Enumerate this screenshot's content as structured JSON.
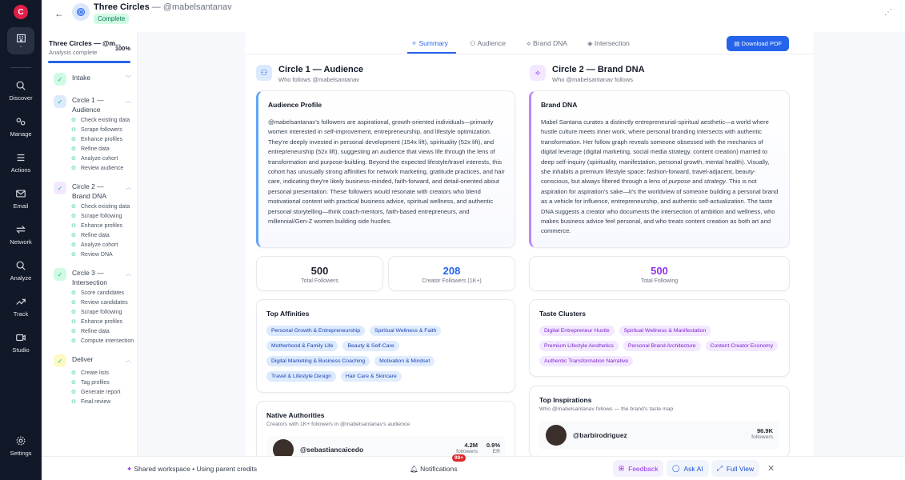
{
  "nav": {
    "logo_text": "C",
    "items": [
      {
        "label": "Discover",
        "icon": "search-icon"
      },
      {
        "label": "Manage",
        "icon": "people-icon"
      },
      {
        "label": "Actions",
        "icon": "list-icon"
      },
      {
        "label": "Email",
        "icon": "mail-icon"
      },
      {
        "label": "Network",
        "icon": "arrows-icon"
      },
      {
        "label": "Analyze",
        "icon": "magnifier-icon"
      },
      {
        "label": "Track",
        "icon": "trend-icon"
      },
      {
        "label": "Studio",
        "icon": "video-icon"
      }
    ],
    "settings": "Settings"
  },
  "header": {
    "title": "Three Circles",
    "handle": " — @mabelsantanav",
    "status": "Complete"
  },
  "sidebar": {
    "title": "Three Circles — @m...",
    "subtitle": "Analysis complete",
    "percent": "100%",
    "progress": 1.0,
    "stages": [
      {
        "name": "Intake",
        "color": "#d1fae5",
        "steps": []
      },
      {
        "name": "Circle 1 — Audience",
        "color": "#dbeafe",
        "steps": [
          "Check existing data",
          "Scrape followers",
          "Enhance profiles",
          "Refine data",
          "Analyze cohort",
          "Review audience"
        ]
      },
      {
        "name": "Circle 2 — Brand DNA",
        "color": "#f3e8ff",
        "steps": [
          "Check existing data",
          "Scrape following",
          "Enhance profiles",
          "Refine data",
          "Analyze cohort",
          "Review DNA"
        ]
      },
      {
        "name": "Circle 3 — Intersection",
        "color": "#d1fae5",
        "steps": [
          "Score candidates",
          "Review candidates",
          "Scrape following",
          "Enhance profiles",
          "Refine data",
          "Compute intersection"
        ]
      },
      {
        "name": "Deliver",
        "color": "#fef9c3",
        "steps": [
          "Create lists",
          "Tag profiles",
          "Generate report",
          "Final review"
        ]
      }
    ]
  },
  "tabs": [
    "Summary",
    "Audience",
    "Brand DNA",
    "Intersection"
  ],
  "download_label": "Download PDF",
  "circle1": {
    "title": "Circle 1 — Audience",
    "subtitle": "Who follows @mabelsantanav",
    "profile_title": "Audience Profile",
    "profile_text": "@mabelsantanav's followers are aspirational, growth-oriented individuals—primarily women interested in self-improvement, entrepreneurship, and lifestyle optimization. They're deeply invested in personal development (154x lift), spirituality (52x lift), and entrepreneurship (52x lift), suggesting an audience that views life through the lens of transformation and purpose-building. Beyond the expected lifestyle/travel interests, this cohort has unusually strong affinities for network marketing, gratitude practices, and hair care, indicating they're likely business-minded, faith-forward, and detail-oriented about personal presentation. These followers would resonate with creators who blend motivational content with practical business advice, spiritual wellness, and authentic personal storytelling—think coach-mentors, faith-based entrepreneurs, and millennial/Gen-Z women building side hustles.",
    "stat1_value": "500",
    "stat1_label": "Total Followers",
    "stat2_value": "208",
    "stat2_label": "Creator Followers (1K+)",
    "affinities_title": "Top Affinities",
    "affinities": [
      "Personal Growth & Entrepreneurship",
      "Spiritual Wellness & Faith",
      "Motherhood & Family Life",
      "Beauty & Self-Care",
      "Digital Marketing & Business Coaching",
      "Motivation & Mindset",
      "Travel & Lifestyle Design",
      "Hair Care & Skincare"
    ],
    "authorities_title": "Native Authorities",
    "authorities_sub": "Creators with 1K+ followers in @mabelsantanav's audience",
    "authority": {
      "name": "@sebastiancaicedo",
      "followers": "4.2M",
      "followers_label": "followers",
      "er": "0.9%",
      "er_label": "ER"
    }
  },
  "circle2": {
    "title": "Circle 2 — Brand DNA",
    "subtitle": "Who @mabelsantanav follows",
    "profile_title": "Brand DNA",
    "profile_text_a": "Mabel Santana curates a distinctly entrepreneurial-spiritual aesthetic—a world where hustle culture meets inner work, where personal branding intersects with authentic transformation. Her follow graph reveals someone obsessed with the mechanics of digital leverage (digital marketing, social media strategy, content creation) married to deep self-inquiry (spirituality, manifestation, personal growth, mental health). Visually, she inhabits a premium lifestyle space: fashion-forward, travel-adjacent, beauty-conscious, but always filtered through a lens of ",
    "profile_em1": "purpose",
    "profile_text_b": " and ",
    "profile_em2": "strategy",
    "profile_text_c": ". This is not aspiration for aspiration's sake—it's the worldview of someone building a personal brand as a vehicle for influence, entrepreneurship, and authentic self-actualization. The taste DNA suggests a creator who documents the intersection of ambition and wellness, who makes business advice feel personal, and who treats content creation as both art and commerce.",
    "stat_value": "500",
    "stat_label": "Total Following",
    "clusters_title": "Taste Clusters",
    "clusters": [
      "Digital Entrepreneur Hustle",
      "Spiritual Wellness & Manifestation",
      "Premium Lifestyle Aesthetics",
      "Personal Brand Architecture",
      "Content Creator Economy",
      "Authentic Transformation Narrative"
    ],
    "inspirations_title": "Top Inspirations",
    "inspirations_sub": "Who @mabelsantanav follows — the brand's taste map",
    "inspiration": {
      "name": "@barbirodriguez",
      "followers": "96.9K",
      "followers_label": "followers"
    }
  },
  "bottom": {
    "workspace": "Shared workspace • Using parent credits",
    "notifications": "Notifications",
    "notif_count": "99+",
    "feedback": "Feedback",
    "ask_ai": "Ask AI",
    "full_view": "Full View"
  }
}
